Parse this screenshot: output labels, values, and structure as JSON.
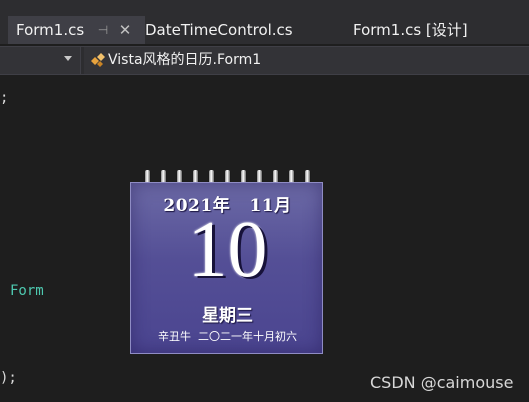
{
  "tabs": [
    {
      "label": "Form1.cs",
      "active": true
    },
    {
      "label": "DateTimeControl.cs",
      "active": false
    },
    {
      "label": "Form1.cs [设计]",
      "active": false
    }
  ],
  "icons": {
    "pin": "pin-icon",
    "close": "close-icon",
    "dropdown": "chevron-down-icon",
    "class": "class-icon"
  },
  "navbar": {
    "class_label": "Vista风格的日历.Form1"
  },
  "code_fragments": {
    "line1": ";",
    "line2": "Form",
    "line3": ");"
  },
  "calendar": {
    "year_month": "2021年   11月",
    "day": "10",
    "weekday": "星期三",
    "lunar": "辛丑牛  二〇二一年十月初六"
  },
  "watermark": "CSDN @caimouse",
  "colors": {
    "background": "#1e1e1e",
    "tab_active": "#3f3f46",
    "keyword_teal": "#4ec9b0",
    "calendar_purple": "#544f96"
  }
}
